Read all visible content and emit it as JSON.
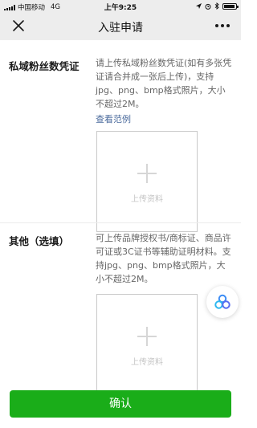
{
  "status_bar": {
    "carrier": "中国移动",
    "network": "4G",
    "time": "上午9:25",
    "battery_level": 0.9
  },
  "nav": {
    "title": "入驻申请",
    "close_icon": "close-icon",
    "more_icon": "more-icon"
  },
  "sections": [
    {
      "label": "私域粉丝数凭证",
      "description": "请上传私域粉丝数凭证(如有多张凭证请合并成一张后上传)，支持jpg、png、bmp格式照片，大小不超过2M。",
      "link": "查看范例",
      "upload_label": "上传资料"
    },
    {
      "label": "其他（选填）",
      "description": "可上传品牌授权书/商标证、商品许可证或3C证书等辅助证明材料。支持jpg、png、bmp格式照片，大小不超过2M。",
      "upload_label": "上传资料"
    }
  ],
  "confirm_label": "确认",
  "colors": {
    "primary": "#1aad19",
    "link": "#4a6a9c",
    "nav_bg": "#ededed"
  }
}
